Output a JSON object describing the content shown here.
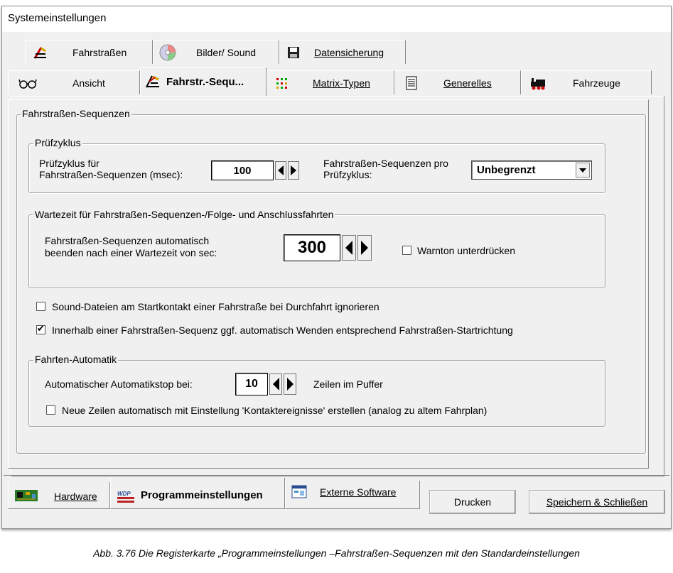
{
  "window": {
    "title": "Systemeinstellungen"
  },
  "tabs_row1": [
    {
      "label": "Fahrstraßen",
      "icon": "route-icon"
    },
    {
      "label": "Bilder/ Sound",
      "icon": "cd-icon"
    },
    {
      "label": "Datensicherung",
      "icon": "floppy-disk-icon"
    }
  ],
  "tabs_row2": [
    {
      "label": "Ansicht",
      "icon": "glasses-icon"
    },
    {
      "label": "Fahrstr.-Sequ...",
      "icon": "route-sequence-icon",
      "active": true
    },
    {
      "label": "Matrix-Typen",
      "icon": "matrix-icon"
    },
    {
      "label": "Generelles",
      "icon": "document-icon"
    },
    {
      "label": "Fahrzeuge",
      "icon": "locomotive-icon"
    }
  ],
  "main_group": {
    "title": "Fahrstraßen-Sequenzen"
  },
  "pruefzyklus": {
    "title": "Prüfzyklus",
    "label_line1": "Prüfzyklus für",
    "label_line2": "Fahrstraßen-Sequenzen (msec):",
    "value": "100",
    "per_cycle_line1": "Fahrstraßen-Sequenzen pro",
    "per_cycle_line2": "Prüfzyklus:",
    "per_cycle_value": "Unbegrenzt"
  },
  "wartezeit": {
    "title": "Wartezeit für Fahrstraßen-Sequenzen-/Folge- und Anschlussfahrten",
    "label_line1": "Fahrstraßen-Sequenzen automatisch",
    "label_line2": "beenden nach einer Wartezeit von sec:",
    "value": "300",
    "warnton_label": "Warnton unterdrücken",
    "warnton_checked": false
  },
  "options": [
    {
      "label": "Sound-Dateien am Startkontakt einer Fahrstraße bei Durchfahrt ignorieren",
      "checked": false
    },
    {
      "label": "Innerhalb einer Fahrstraßen-Sequenz ggf. automatisch Wenden entsprechend Fahrstraßen-Startrichtung",
      "checked": true
    }
  ],
  "automatik": {
    "title": "Fahrten-Automatik",
    "label": "Automatischer Automatikstop bei:",
    "value": "10",
    "suffix": "Zeilen im Puffer",
    "new_rows_label": "Neue Zeilen automatisch mit Einstellung 'Kontaktereignisse' erstellen (analog zu altem Fahrplan)",
    "new_rows_checked": false
  },
  "bottom_tabs": [
    {
      "label": "Hardware",
      "icon": "circuit-board-icon"
    },
    {
      "label": "Programmeinstellungen",
      "icon": "program-icon",
      "active": true
    },
    {
      "label": "Externe Software",
      "icon": "window-app-icon"
    }
  ],
  "buttons": {
    "print": "Drucken",
    "save_close": "Speichern & Schließen"
  },
  "caption": "Abb. 3.76    Die Registerkarte „Programmeinstellungen –Fahrstraßen-Sequenzen  mit den Standardeinstellungen"
}
